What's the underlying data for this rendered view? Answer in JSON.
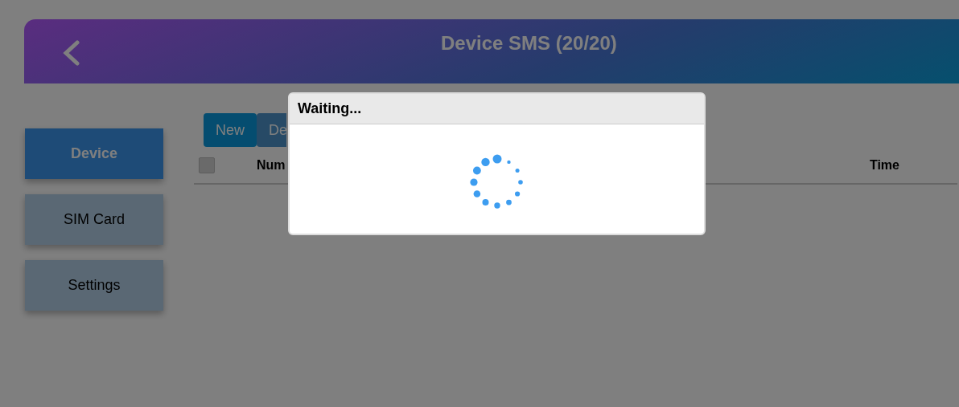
{
  "header": {
    "title": "Device SMS (20/20)"
  },
  "sidebar": {
    "items": [
      {
        "label": "Device",
        "selected": true
      },
      {
        "label": "SIM Card",
        "selected": false
      },
      {
        "label": "Settings",
        "selected": false
      }
    ]
  },
  "toolbar": {
    "buttons": [
      {
        "label": "New",
        "kind": "primary"
      },
      {
        "label": "De",
        "kind": "secondary"
      }
    ]
  },
  "table": {
    "select_all": {
      "checked": false
    },
    "columns": [
      "Num",
      "Time"
    ]
  },
  "dialog": {
    "title": "Waiting..."
  }
}
